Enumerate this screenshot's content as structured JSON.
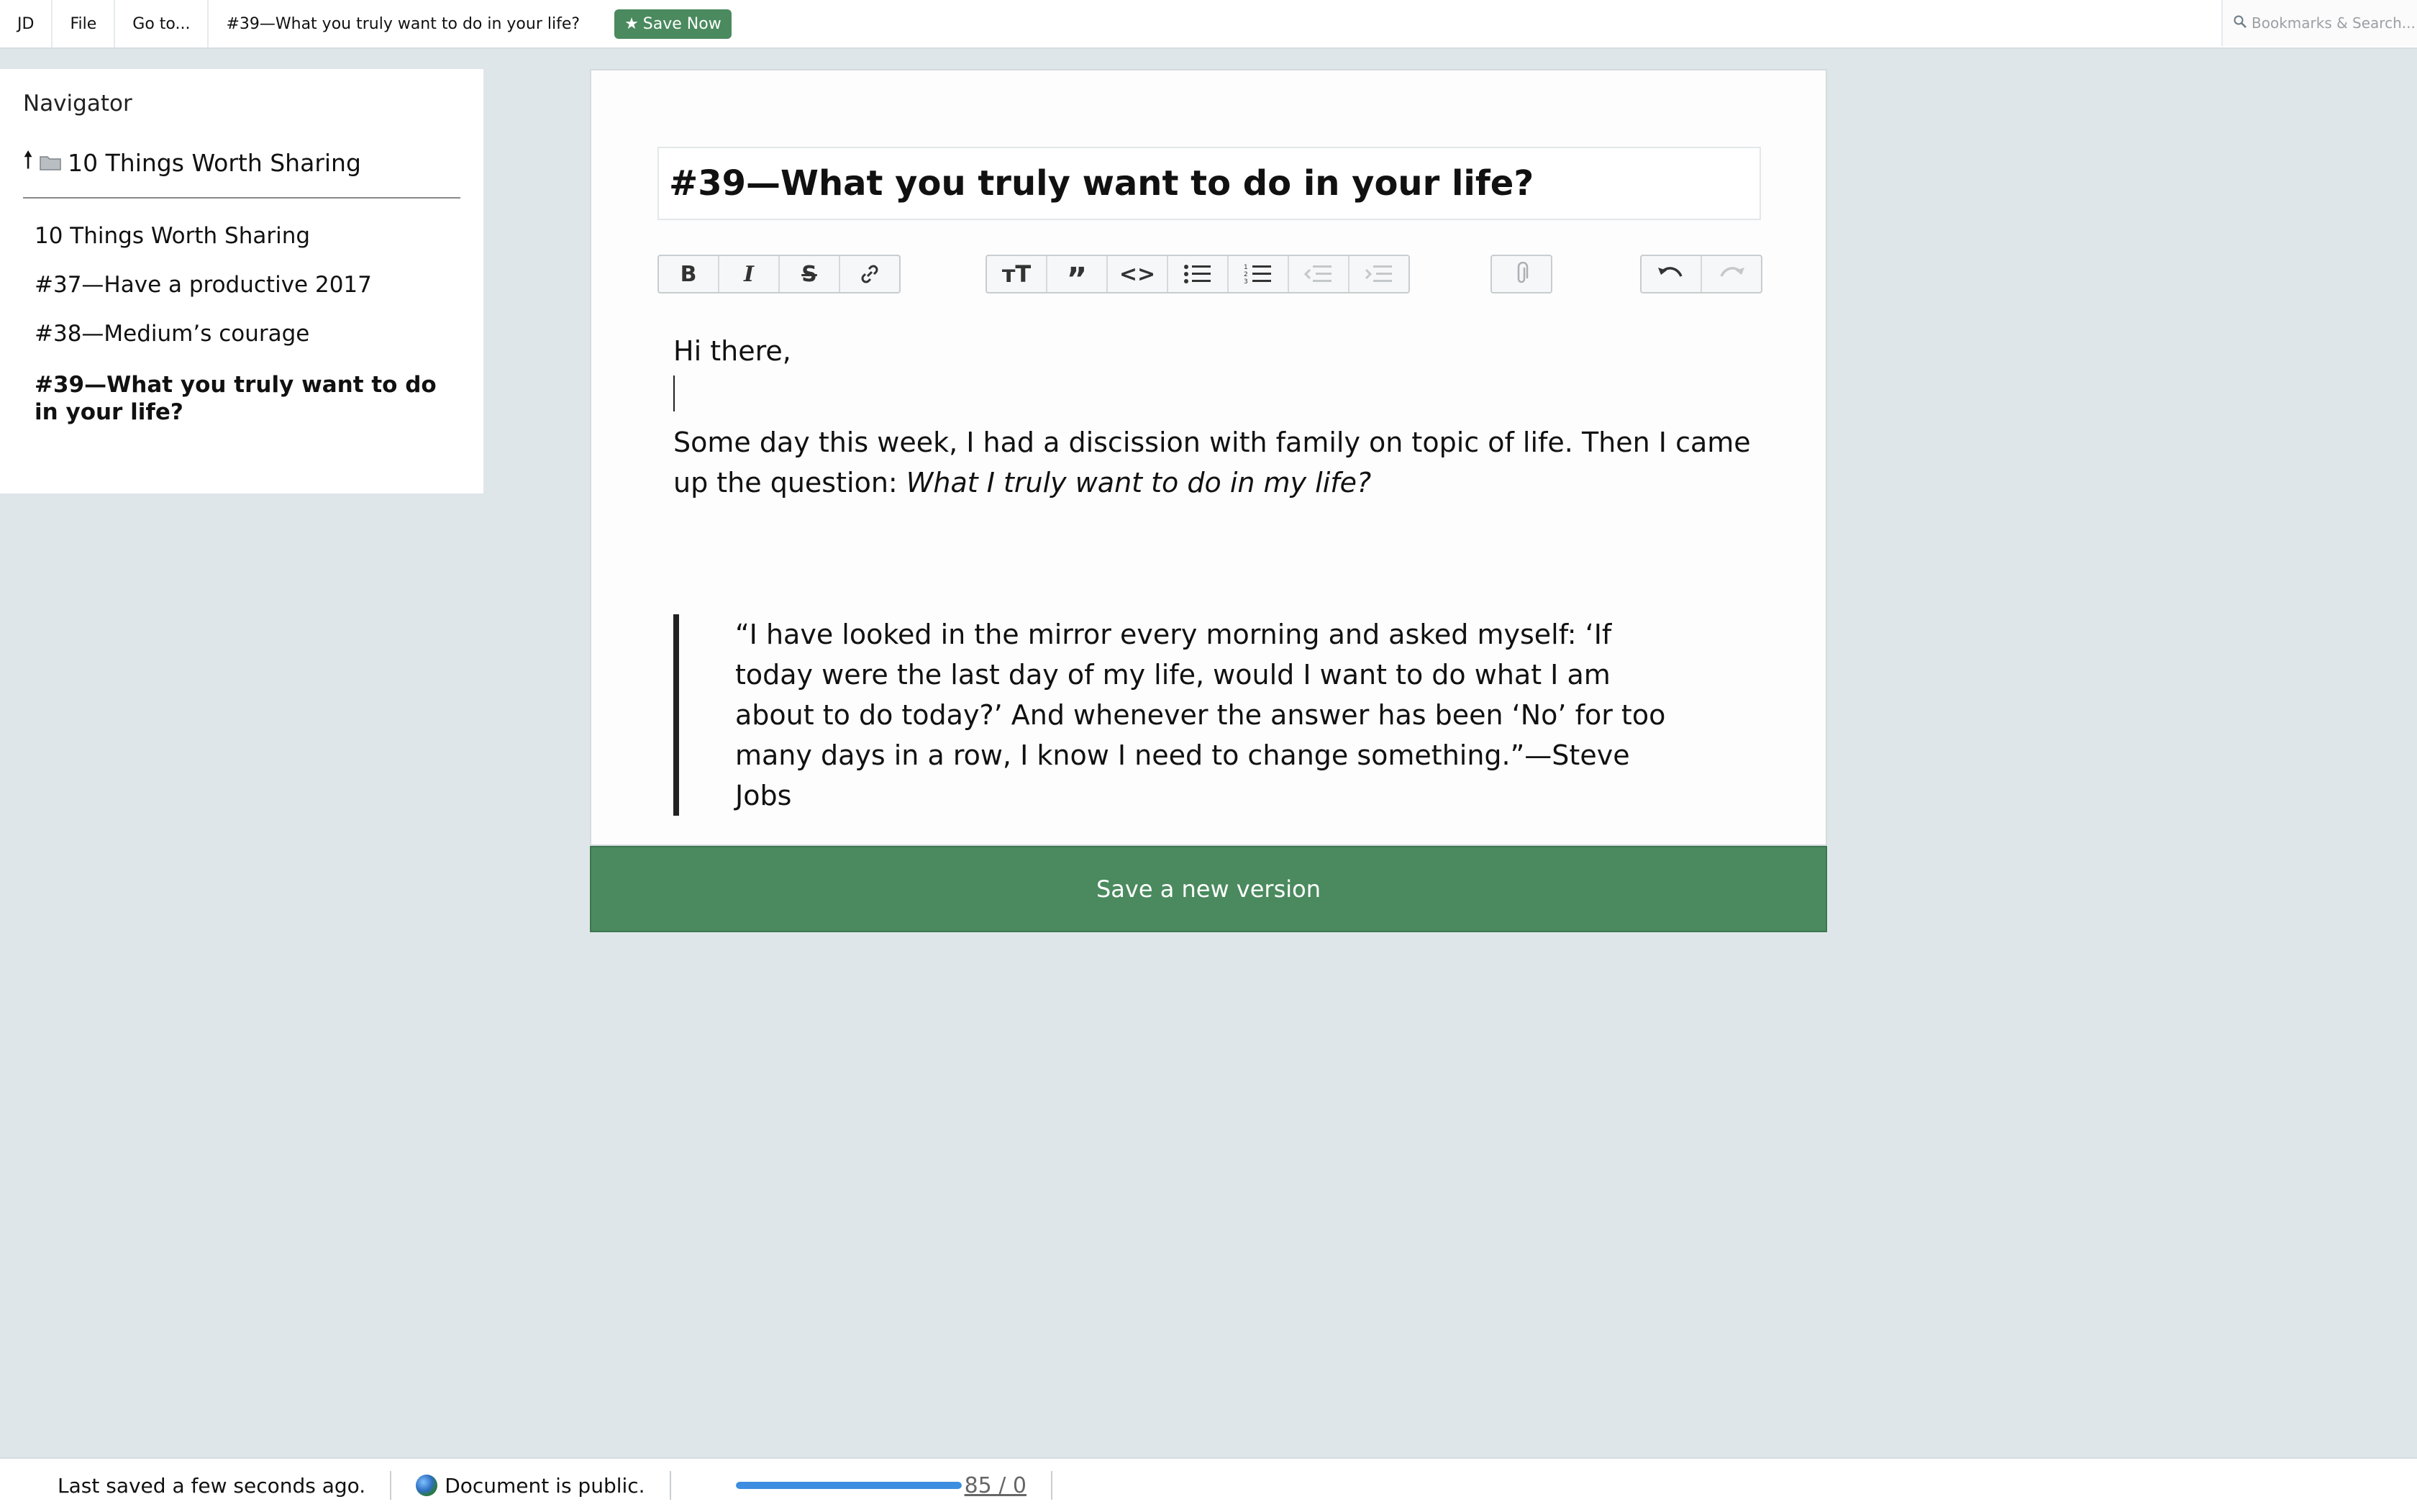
{
  "topbar": {
    "user": "JD",
    "file": "File",
    "goto": "Go to...",
    "doc_title": "#39—What you truly want to do in your life?",
    "save_now": "Save Now",
    "save_icon": "star-icon",
    "search_placeholder": "Bookmarks & Search...",
    "accent": "#4a8a5e"
  },
  "navigator": {
    "title": "Navigator",
    "parent": "10 Things Worth Sharing",
    "items": [
      "10 Things Worth Sharing",
      "#37—Have a productive 2017",
      "#38—Medium’s courage",
      "#39—What you truly want to do in your life?"
    ]
  },
  "editor": {
    "title": "#39—What you truly want to do in your life?",
    "toolbar": [
      "bold-icon",
      "italic-icon",
      "strikethrough-icon",
      "link-icon",
      "heading-icon",
      "quote-icon",
      "code-icon",
      "bullet-list-icon",
      "numbered-list-icon",
      "outdent-icon",
      "indent-icon",
      "attach-icon",
      "undo-icon",
      "redo-icon"
    ],
    "greeting": "Hi there,",
    "para1": "Some day this week, I had a discission with family on topic of life. Then I came up the question: ",
    "para1_em": "What I truly want to do in my life?",
    "quote": "“I have looked in the mirror every morning and asked myself: ‘If today were the last day of my life, would I want to do what I am about to do today?’ And whenever the answer has been ‘No’ for too many days in a row, I know I need to change something.”—Steve Jobs"
  },
  "save_version": "Save a new version",
  "status": {
    "last_saved": "Last saved a few seconds ago.",
    "visibility": "Document is public.",
    "progress_fraction": 1.0,
    "count": "85 / 0"
  }
}
